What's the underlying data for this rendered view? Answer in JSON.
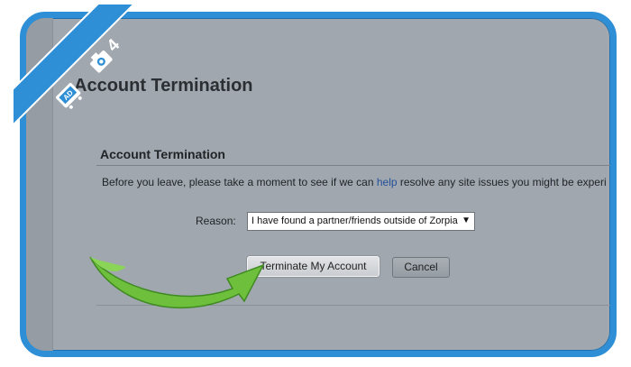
{
  "page": {
    "heading": "Account Termination",
    "section_title": "Account Termination",
    "intro_before": "Before you leave, please take a moment to see if we can ",
    "intro_link": "help",
    "intro_after": " resolve any site issues you might be experi"
  },
  "form": {
    "reason_label": "Reason:",
    "reason_value": "I have found a partner/friends outside of Zorpia",
    "reason_arrow": "▼"
  },
  "buttons": {
    "terminate_label": "Terminate My Account",
    "cancel_label": "Cancel"
  },
  "badge": {
    "step_number": "4",
    "icons": [
      "camera-icon",
      "ad-store-icon"
    ]
  },
  "colors": {
    "frame_blue": "#2f8fd6",
    "annotation_green": "#6ec03c",
    "link_blue": "#24509a"
  }
}
